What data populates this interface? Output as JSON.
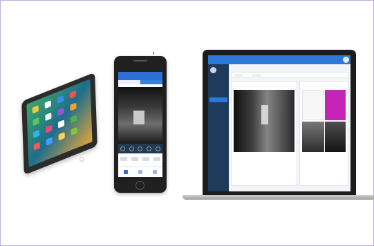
{
  "tablet": {
    "watermark": "",
    "app_colors": [
      "#f4c542",
      "#ffffff",
      "#3a8ee6",
      "#e8554e",
      "#59c36a",
      "#f0f0f0",
      "#8a5cd1",
      "#ff9d2e",
      "#2fb3e6",
      "#e84a7a",
      "#ffffff",
      "#4caf50",
      "#f25c54",
      "#3aa0ff",
      "#ffd24d",
      "#7ac943"
    ]
  },
  "phone": {
    "header_title": "",
    "tabs": [
      "",
      ""
    ],
    "video_title": ""
  },
  "laptop": {
    "logo": "",
    "nav": [
      "",
      "",
      ""
    ],
    "top_right": [
      "",
      ""
    ],
    "sidebar_items": [
      "",
      "",
      "",
      "",
      "",
      "",
      "",
      "",
      "",
      ""
    ],
    "breadcrumb": "",
    "toolbar_chips": [
      "",
      ""
    ],
    "left_panel_title": "",
    "right_panel_title": "",
    "footer_items": [
      "",
      "",
      ""
    ]
  }
}
